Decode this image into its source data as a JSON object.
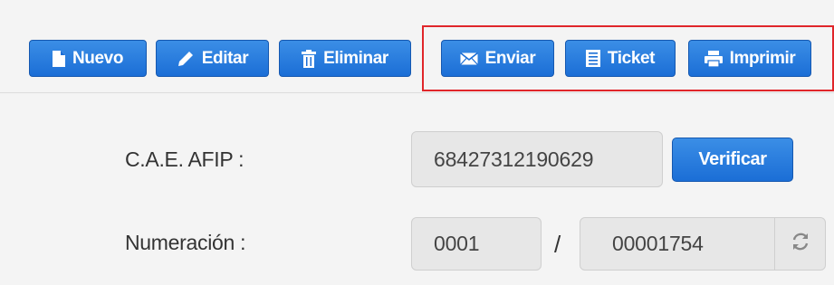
{
  "toolbar": {
    "buttons": [
      {
        "label": "Nuevo",
        "icon": "file-icon"
      },
      {
        "label": "Editar",
        "icon": "pencil-icon"
      },
      {
        "label": "Eliminar",
        "icon": "trash-icon"
      },
      {
        "label": "Enviar",
        "icon": "envelope-icon"
      },
      {
        "label": "Ticket",
        "icon": "list-icon"
      },
      {
        "label": "Imprimir",
        "icon": "printer-icon"
      }
    ]
  },
  "form": {
    "cae_label": "C.A.E. AFIP :",
    "cae_value": "68427312190629",
    "verify_label": "Verificar",
    "numeracion_label": "Numeración :",
    "punto_venta": "0001",
    "separator": "/",
    "numero": "00001754"
  },
  "colors": {
    "button_blue": "#1f75de",
    "highlight_red": "#e0262a"
  }
}
